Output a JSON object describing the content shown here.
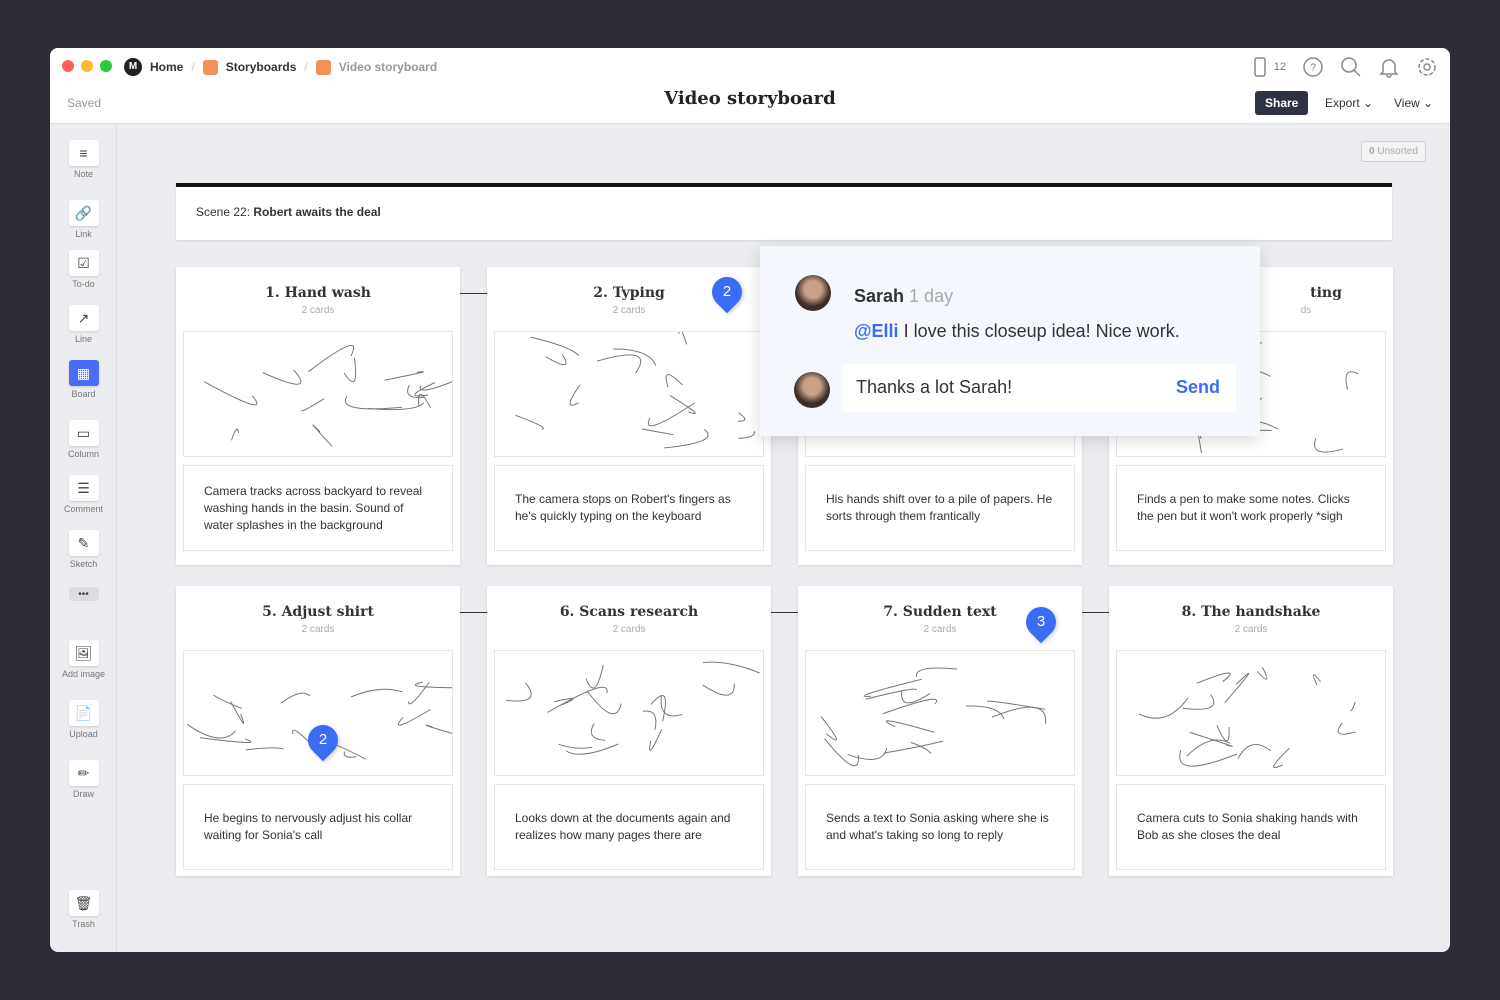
{
  "breadcrumb": [
    "Home",
    "Storyboards",
    "Video storyboard"
  ],
  "status": "Saved",
  "title": "Video storyboard",
  "device_count": "12",
  "share": "Share",
  "export": "Export",
  "view": "View",
  "toolbar": [
    {
      "label": "Note",
      "icon": "≡"
    },
    {
      "label": "Link",
      "icon": "🔗"
    },
    {
      "label": "To-do",
      "icon": "☑"
    },
    {
      "label": "Line",
      "icon": "↗"
    },
    {
      "label": "Board",
      "icon": "▦"
    },
    {
      "label": "Column",
      "icon": "▭"
    },
    {
      "label": "Comment",
      "icon": "☰"
    },
    {
      "label": "Sketch",
      "icon": "✎"
    },
    {
      "label": "",
      "icon": "•••"
    },
    {
      "label": "Add image",
      "icon": "🖼"
    },
    {
      "label": "Upload",
      "icon": "📄"
    },
    {
      "label": "Draw",
      "icon": "✏"
    },
    {
      "label": "Trash",
      "icon": "🗑"
    }
  ],
  "unsorted": {
    "count": "0",
    "label": "Unsorted"
  },
  "scene": {
    "prefix": "Scene 22:",
    "name": "Robert awaits the deal"
  },
  "cards": [
    {
      "title": "1. Hand wash",
      "sub": "2 cards",
      "text": "Camera tracks across backyard to reveal washing hands in the basin. Sound of water splashes in the background"
    },
    {
      "title": "2. Typing",
      "sub": "2 cards",
      "text": "The camera stops on Robert's fingers as he's quickly typing on the keyboard"
    },
    {
      "title": "",
      "sub": "",
      "text": "His hands shift over to a pile of papers. He sorts through them frantically"
    },
    {
      "title": "ting",
      "sub": "ds",
      "text": "Finds a pen to make some notes. Clicks the pen but it won't work properly *sigh"
    },
    {
      "title": "5. Adjust shirt",
      "sub": "2 cards",
      "text": "He begins to nervously adjust his collar waiting for Sonia's call"
    },
    {
      "title": "6. Scans research",
      "sub": "2 cards",
      "text": "Looks down at the documents again and realizes how many pages there are"
    },
    {
      "title": "7. Sudden text",
      "sub": "2 cards",
      "text": "Sends a text to Sonia asking where she is and what's taking so long to reply"
    },
    {
      "title": "8. The handshake",
      "sub": "2 cards",
      "text": "Camera cuts to Sonia shaking hands with Bob as she closes the deal"
    }
  ],
  "badges": [
    "2",
    "2",
    "3"
  ],
  "comment": {
    "author": "Sarah",
    "time": "1 day",
    "mention": "@Elli",
    "text": " I love this closeup idea! Nice work.",
    "reply": "Thanks a lot Sarah!",
    "send": "Send"
  },
  "colors": {
    "accent": "#3b6cf5",
    "share_bg": "#2d3340"
  }
}
